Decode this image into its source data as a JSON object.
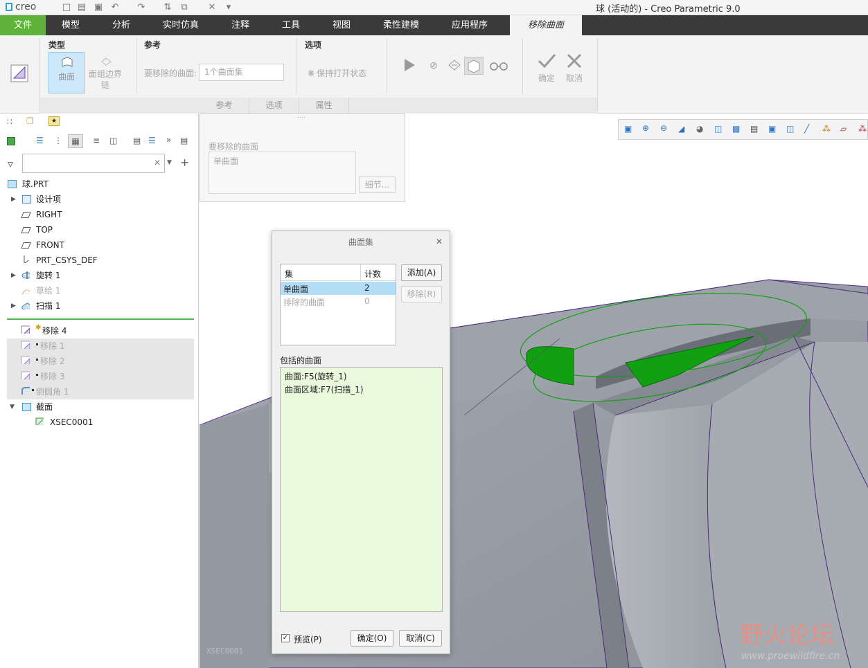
{
  "app": {
    "logo_text": "creo",
    "window_title": "球 (活动的) - Creo Parametric 9.0"
  },
  "menu": {
    "items": [
      "文件",
      "模型",
      "分析",
      "实时仿真",
      "注释",
      "工具",
      "视图",
      "柔性建模",
      "应用程序"
    ],
    "active": "移除曲面"
  },
  "ribbon": {
    "type_group": {
      "title": "类型",
      "surface": "曲面",
      "chain_line1": "面组边界",
      "chain_line2": "链"
    },
    "ref_group": {
      "title": "参考",
      "label": "要移除的曲面:",
      "value": "1个曲面集"
    },
    "options_group": {
      "title": "选项",
      "keep_open": "保持打开状态"
    },
    "ok": "确定",
    "cancel": "取消",
    "subtabs": [
      "参考",
      "选项",
      "属性"
    ]
  },
  "ref_panel": {
    "label": "要移除的曲面",
    "item": "单曲面",
    "details_button": "细节..."
  },
  "tree": {
    "search_placeholder": "",
    "items": [
      {
        "label": "球.PRT",
        "icon": "part-icon"
      },
      {
        "label": "设计项",
        "icon": "design-items-icon"
      },
      {
        "label": "RIGHT",
        "icon": "datum-plane-icon"
      },
      {
        "label": "TOP",
        "icon": "datum-plane-icon"
      },
      {
        "label": "FRONT",
        "icon": "datum-plane-icon"
      },
      {
        "label": "PRT_CSYS_DEF",
        "icon": "csys-icon"
      },
      {
        "label": "旋转 1",
        "icon": "revolve-icon"
      },
      {
        "label": "草绘 1",
        "icon": "sketch-icon"
      },
      {
        "label": "扫描 1",
        "icon": "sweep-icon"
      },
      {
        "label": "移除 4",
        "icon": "remove-surface-icon"
      },
      {
        "label": "移除 1",
        "icon": "remove-surface-icon"
      },
      {
        "label": "移除 2",
        "icon": "remove-surface-icon"
      },
      {
        "label": "移除 3",
        "icon": "remove-surface-icon"
      },
      {
        "label": "倒圆角 1",
        "icon": "round-icon"
      },
      {
        "label": "截面",
        "icon": "section-icon"
      },
      {
        "label": "XSEC0001",
        "icon": "xsec-icon"
      }
    ]
  },
  "dialog": {
    "title": "曲面集",
    "table": {
      "headers": [
        "集",
        "计数"
      ],
      "rows": [
        {
          "name": "单曲面",
          "count": "2"
        },
        {
          "name": "排除的曲面",
          "count": "0"
        }
      ]
    },
    "add_button": "添加(A)",
    "remove_button": "移除(R)",
    "included_label": "包括的曲面",
    "included": [
      "曲面:F5(旋转_1)",
      "曲面区域:F7(扫描_1)"
    ],
    "preview_label": "预览(P)",
    "ok_button": "确定(O)",
    "cancel_button": "取消(C)"
  },
  "watermark": {
    "name": "野火论坛",
    "url": "www.proewildfire.cn",
    "viewport_label": "XSEC0001"
  },
  "colors": {
    "menu_bg": "#3a3a3a",
    "file_tab": "#5fb33a",
    "highlight": "#b3dcf7",
    "included_bg": "#eaf9dc",
    "model_grey": "#8f949c",
    "selection_green": "#11a011"
  }
}
